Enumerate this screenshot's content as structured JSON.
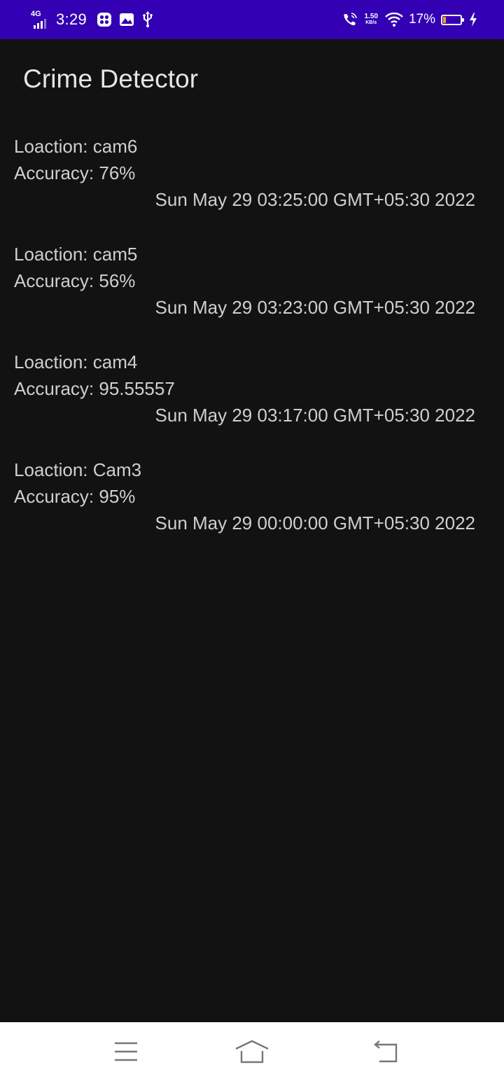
{
  "status_bar": {
    "network": "4G",
    "time": "3:29",
    "speed_value": "1.50",
    "speed_unit": "KB/s",
    "battery_percent": "17%",
    "battery_level": 0.17
  },
  "app_bar": {
    "title": "Crime Detector"
  },
  "detections": [
    {
      "location": "Loaction: cam6",
      "accuracy": "Accuracy: 76%",
      "date": "Sun May 29 03:25:00 GMT+05:30 2022"
    },
    {
      "location": "Loaction: cam5",
      "accuracy": "Accuracy: 56%",
      "date": "Sun May 29 03:23:00 GMT+05:30 2022"
    },
    {
      "location": "Loaction: cam4",
      "accuracy": "Accuracy: 95.55557",
      "date": "Sun May 29 03:17:00 GMT+05:30 2022"
    },
    {
      "location": "Loaction: Cam3",
      "accuracy": "Accuracy: 95%",
      "date": "Sun May 29 00:00:00 GMT+05:30 2022"
    }
  ],
  "nav_bar": {
    "icons": [
      "menu-icon",
      "home-icon",
      "back-icon"
    ]
  },
  "colors": {
    "status_bar": "#3300b3",
    "background": "#121212",
    "text": "#cfcfcf",
    "title": "#e6e6e6",
    "battery_fill": "#f5a623"
  }
}
